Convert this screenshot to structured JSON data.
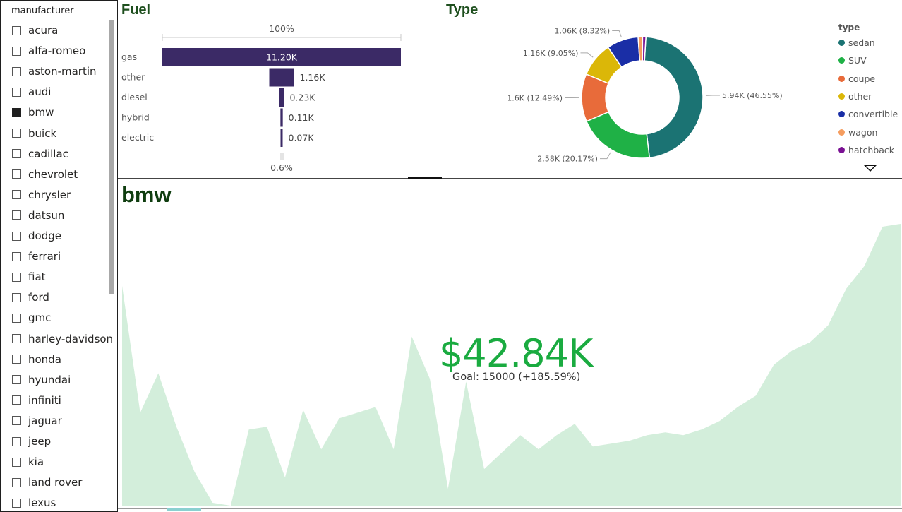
{
  "slicer": {
    "title": "manufacturer",
    "items": [
      {
        "label": "acura",
        "checked": false
      },
      {
        "label": "alfa-romeo",
        "checked": false
      },
      {
        "label": "aston-martin",
        "checked": false
      },
      {
        "label": "audi",
        "checked": false
      },
      {
        "label": "bmw",
        "checked": true
      },
      {
        "label": "buick",
        "checked": false
      },
      {
        "label": "cadillac",
        "checked": false
      },
      {
        "label": "chevrolet",
        "checked": false
      },
      {
        "label": "chrysler",
        "checked": false
      },
      {
        "label": "datsun",
        "checked": false
      },
      {
        "label": "dodge",
        "checked": false
      },
      {
        "label": "ferrari",
        "checked": false
      },
      {
        "label": "fiat",
        "checked": false
      },
      {
        "label": "ford",
        "checked": false
      },
      {
        "label": "gmc",
        "checked": false
      },
      {
        "label": "harley-davidson",
        "checked": false
      },
      {
        "label": "honda",
        "checked": false
      },
      {
        "label": "hyundai",
        "checked": false
      },
      {
        "label": "infiniti",
        "checked": false
      },
      {
        "label": "jaguar",
        "checked": false
      },
      {
        "label": "jeep",
        "checked": false
      },
      {
        "label": "kia",
        "checked": false
      },
      {
        "label": "land rover",
        "checked": false
      },
      {
        "label": "lexus",
        "checked": false
      }
    ]
  },
  "fuel": {
    "title": "Fuel",
    "top_pct_label": "100%",
    "bottom_pct_label": "0.6%",
    "bar_color": "#3b2a66"
  },
  "type": {
    "title": "Type",
    "legend_title": "type"
  },
  "card": {
    "title": "bmw",
    "value": "$42.84K",
    "goal_text": "Goal: 15000 (+185.59%)",
    "check_icon": "✓",
    "value_color": "#1aab40",
    "area_color": "#d3eedb"
  },
  "chart_data": [
    {
      "type": "bar",
      "subtype": "funnel",
      "categories": [
        "gas",
        "other",
        "diesel",
        "hybrid",
        "electric"
      ],
      "values": [
        11200,
        1160,
        230,
        110,
        70
      ],
      "value_labels": [
        "11.20K",
        "1.16K",
        "0.23K",
        "0.11K",
        "0.07K"
      ],
      "title": "Fuel"
    },
    {
      "type": "pie",
      "subtype": "donut",
      "categories": [
        "sedan",
        "SUV",
        "coupe",
        "other",
        "convertible",
        "wagon",
        "hatchback"
      ],
      "values": [
        5940,
        2580,
        1600,
        1160,
        1060,
        150,
        110
      ],
      "value_labels": [
        "5.94K (46.55%)",
        "2.58K (20.17%)",
        "1.6K (12.49%)",
        "1.16K (9.05%)",
        "1.06K (8.32%)",
        "",
        ""
      ],
      "colors": [
        "#1b7373",
        "#1fb146",
        "#e86b3a",
        "#dbb708",
        "#1a2ea6",
        "#f59d5f",
        "#7a1193"
      ],
      "title": "Type",
      "legend_title": "type",
      "legend": "right"
    },
    {
      "type": "area",
      "title": "",
      "values": [
        0.78,
        0.33,
        0.47,
        0.28,
        0.12,
        0.01,
        0.0,
        0.27,
        0.28,
        0.1,
        0.34,
        0.2,
        0.31,
        0.33,
        0.35,
        0.2,
        0.6,
        0.45,
        0.06,
        0.44,
        0.13,
        0.19,
        0.25,
        0.2,
        0.25,
        0.29,
        0.21,
        0.22,
        0.23,
        0.25,
        0.26,
        0.25,
        0.27,
        0.3,
        0.35,
        0.39,
        0.5,
        0.55,
        0.58,
        0.64,
        0.77,
        0.85,
        0.99,
        1.0
      ],
      "ylim": [
        0,
        1.05
      ],
      "grid": false
    }
  ]
}
